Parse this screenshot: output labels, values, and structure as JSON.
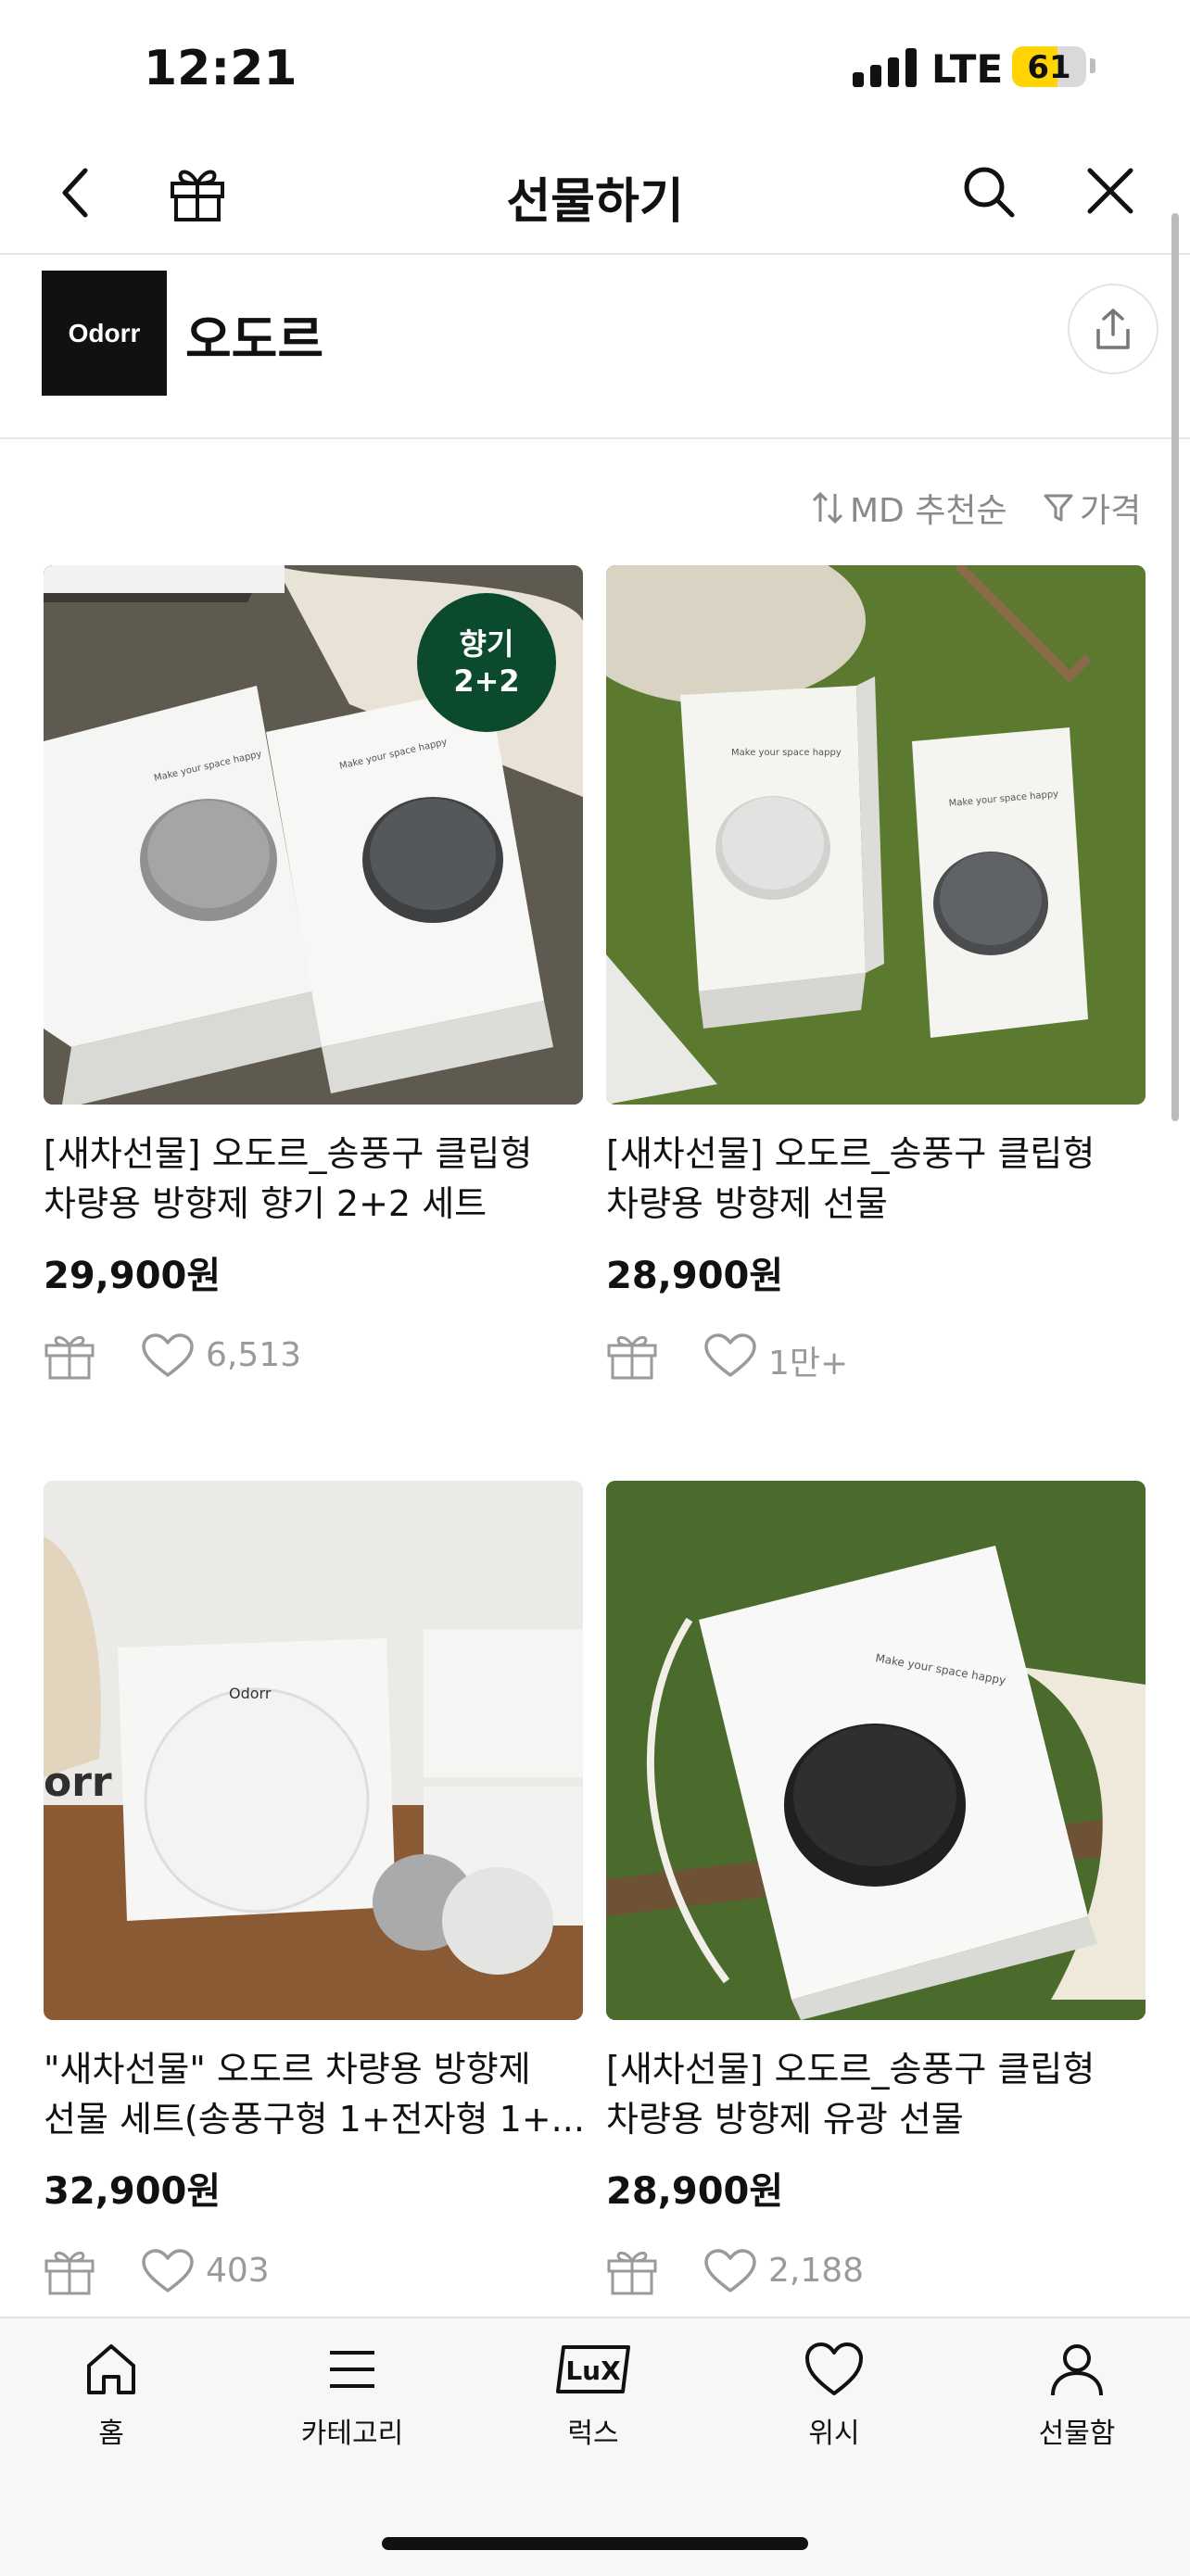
{
  "status": {
    "time": "12:21",
    "network": "LTE",
    "battery": "61",
    "battery_level": 0.61
  },
  "header": {
    "title": "선물하기"
  },
  "brand": {
    "logo_text": "Odorr",
    "name": "오도르"
  },
  "sort": {
    "label": "MD 추천순",
    "filter_label": "가격"
  },
  "products": [
    {
      "title_line1": "[새차선물] 오도르_송풍구 클립형",
      "title_line2": "차량용 방향제 향기 2+2 세트",
      "price": "29,900원",
      "likes": "6,513",
      "badge_line1": "향기",
      "badge_line2": "2+2"
    },
    {
      "title_line1": "[새차선물] 오도르_송풍구 클립형",
      "title_line2": "차량용 방향제 선물",
      "price": "28,900원",
      "likes": "1만+"
    },
    {
      "title_line1": "\"새차선물\" 오도르 차량용 방향제",
      "title_line2": "선물 세트(송풍구형 1+전자형 1+...",
      "price": "32,900원",
      "likes": "403"
    },
    {
      "title_line1": "[새차선물] 오도르_송풍구 클립형",
      "title_line2": "차량용 방향제 유광 선물",
      "price": "28,900원",
      "likes": "2,188"
    }
  ],
  "tabs": [
    {
      "label": "홈",
      "icon": "home-icon"
    },
    {
      "label": "카테고리",
      "icon": "menu-icon"
    },
    {
      "label": "럭스",
      "icon": "lux-icon",
      "icon_text": "LuX"
    },
    {
      "label": "위시",
      "icon": "heart-icon"
    },
    {
      "label": "선물함",
      "icon": "person-icon"
    }
  ],
  "colors": {
    "badge": "#0b4a2c",
    "battery": "#ffd400",
    "muted": "#9a9a9a"
  }
}
